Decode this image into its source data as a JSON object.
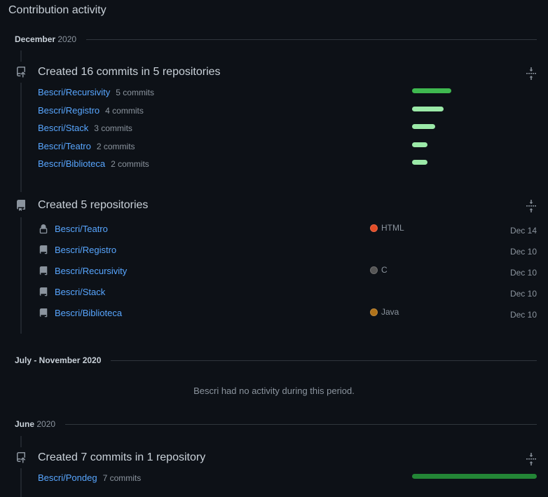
{
  "page_title": "Contribution activity",
  "periods": [
    {
      "month": "December",
      "year": "2020"
    },
    {
      "month": "July - November 2020",
      "year": ""
    },
    {
      "month": "June",
      "year": "2020"
    }
  ],
  "commits_dec": {
    "title": "Created 16 commits in 5 repositories",
    "rows": [
      {
        "repo": "Bescri/Recursivity",
        "count": "5 commits",
        "commits": 5
      },
      {
        "repo": "Bescri/Registro",
        "count": "4 commits",
        "commits": 4
      },
      {
        "repo": "Bescri/Stack",
        "count": "3 commits",
        "commits": 3
      },
      {
        "repo": "Bescri/Teatro",
        "count": "2 commits",
        "commits": 2
      },
      {
        "repo": "Bescri/Biblioteca",
        "count": "2 commits",
        "commits": 2
      }
    ]
  },
  "repos_dec": {
    "title": "Created 5 repositories",
    "rows": [
      {
        "repo": "Bescri/Teatro",
        "lang": "HTML",
        "lang_color": "#e34c26",
        "date": "Dec 14",
        "icon": "lock-icon"
      },
      {
        "repo": "Bescri/Registro",
        "lang": "",
        "lang_color": "",
        "date": "Dec 10",
        "icon": "repo-icon"
      },
      {
        "repo": "Bescri/Recursivity",
        "lang": "C",
        "lang_color": "#555555",
        "date": "Dec 10",
        "icon": "repo-icon"
      },
      {
        "repo": "Bescri/Stack",
        "lang": "",
        "lang_color": "",
        "date": "Dec 10",
        "icon": "repo-icon"
      },
      {
        "repo": "Bescri/Biblioteca",
        "lang": "Java",
        "lang_color": "#b07219",
        "date": "Dec 10",
        "icon": "repo-icon"
      }
    ]
  },
  "empty_message": "Bescri had no activity during this period.",
  "commits_jun": {
    "title": "Created 7 commits in 1 repository",
    "rows": [
      {
        "repo": "Bescri/Pondeg",
        "count": "7 commits",
        "commits": 7
      }
    ]
  },
  "colors": {
    "bar_bright": "#3fb950",
    "bar_light": "#9be9a8",
    "bar_dark": "#238636",
    "link": "#58a6ff"
  }
}
